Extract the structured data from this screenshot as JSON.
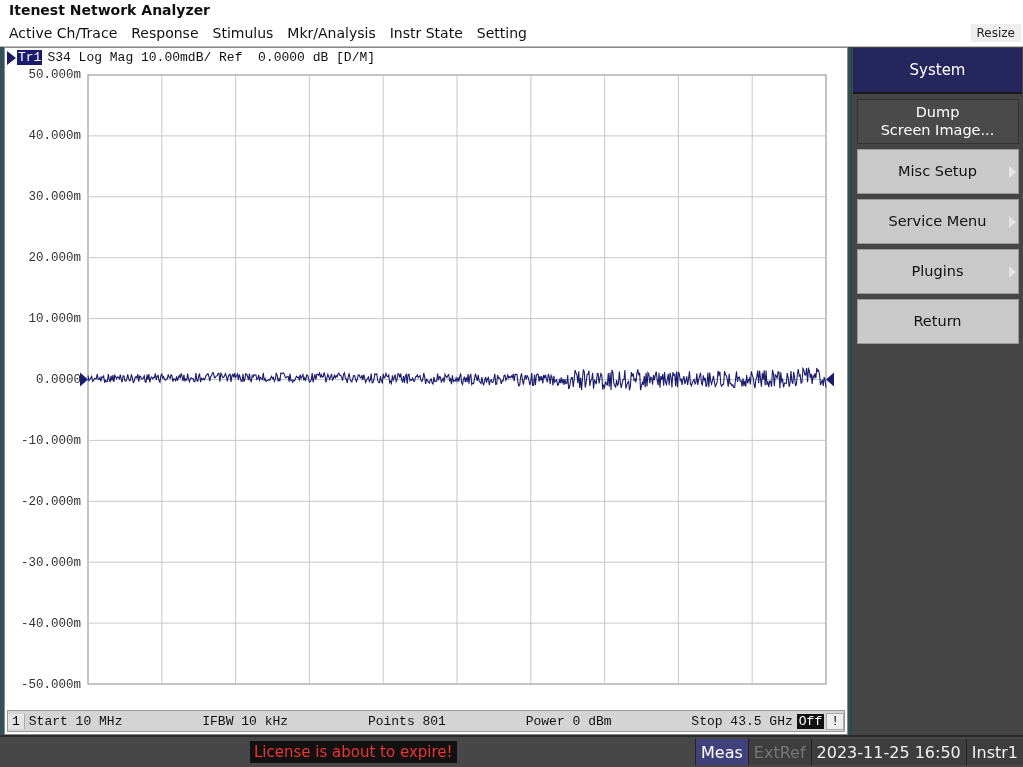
{
  "window": {
    "title": "Itenest Network Analyzer"
  },
  "menu": [
    "Active Ch/Trace",
    "Response",
    "Stimulus",
    "Mkr/Analysis",
    "Instr State",
    "Setting"
  ],
  "resize_button": "Resize",
  "trace_header": {
    "trace": "Tr1",
    "text": "S34 Log Mag 10.00mdB/ Ref  0.0000 dB [D/M]"
  },
  "y_labels": [
    "50.000m",
    "40.000m",
    "30.000m",
    "20.000m",
    "10.000m",
    "0.0000",
    "-10.000m",
    "-20.000m",
    "-30.000m",
    "-40.000m",
    "-50.000m"
  ],
  "channel_bar": {
    "channel": "1",
    "fields": [
      "Start 10 MHz",
      "IFBW 10 kHz",
      "Points 801",
      "Power 0 dBm",
      "Stop 43.5 GHz"
    ],
    "off": "Off",
    "alert": "!"
  },
  "softkeys": {
    "title": "System",
    "items": [
      {
        "label": "Dump\nScreen Image...",
        "selected": true,
        "submenu": false
      },
      {
        "label": "Misc Setup",
        "selected": false,
        "submenu": true
      },
      {
        "label": "Service Menu",
        "selected": false,
        "submenu": true
      },
      {
        "label": "Plugins",
        "selected": false,
        "submenu": true
      },
      {
        "label": "Return",
        "selected": false,
        "submenu": false
      }
    ]
  },
  "status_bar": {
    "message": "License is about to expire!",
    "indicators": [
      {
        "label": "Meas",
        "on": true
      },
      {
        "label": "ExtRef",
        "on": false
      }
    ],
    "datetime": "2023-11-25 16:50",
    "instrument": "Instr1"
  }
}
